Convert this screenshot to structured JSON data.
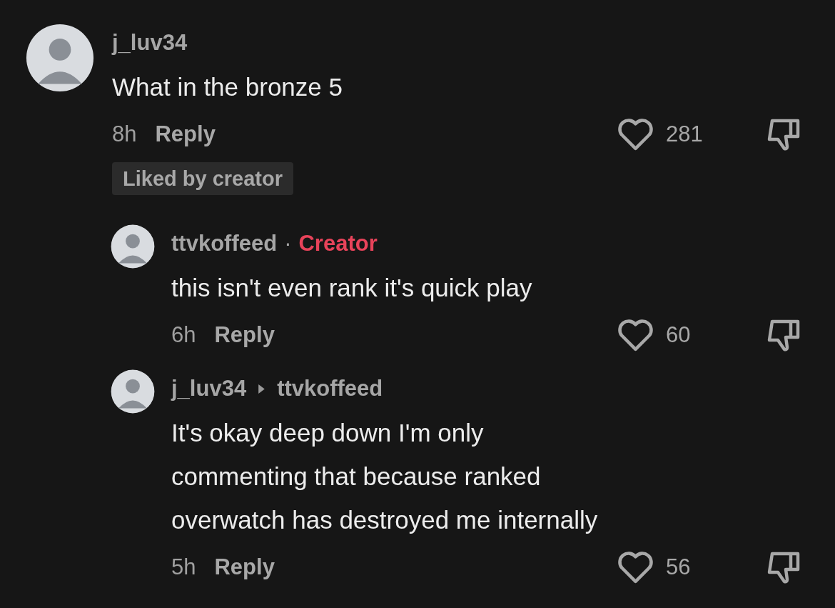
{
  "comments": [
    {
      "kind": "comment",
      "username": "j_luv34",
      "text_lines": [
        "What in the bronze 5"
      ],
      "time": "8h",
      "reply_label": "Reply",
      "liked": false,
      "likes": "281",
      "liked_by_creator": "Liked by creator"
    },
    {
      "kind": "reply",
      "username": "ttvkoffeed",
      "separator": "·",
      "author_badge": "Creator",
      "text_lines": [
        "this isn't even rank it's quick play"
      ],
      "time": "6h",
      "reply_label": "Reply",
      "liked": false,
      "likes": "60"
    },
    {
      "kind": "reply",
      "username": "j_luv34",
      "reply_to": "ttvkoffeed",
      "text_lines": [
        "It's okay deep down I'm only",
        "commenting that because ranked",
        "overwatch has destroyed me internally"
      ],
      "time": "5h",
      "reply_label": "Reply",
      "liked": false,
      "likes": "56"
    }
  ]
}
